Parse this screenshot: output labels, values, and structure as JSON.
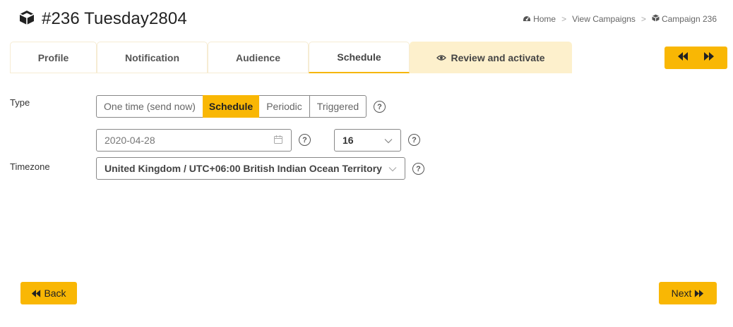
{
  "header": {
    "title": "#236 Tuesday2804",
    "title_icon": "cube-icon"
  },
  "breadcrumb": {
    "items": [
      {
        "label": "Home",
        "icon": "dashboard-icon"
      },
      {
        "label": "View Campaigns"
      },
      {
        "label": "Campaign 236",
        "icon": "cube-icon"
      }
    ],
    "separator": ">"
  },
  "tabs": [
    {
      "label": "Profile"
    },
    {
      "label": "Notification"
    },
    {
      "label": "Audience"
    },
    {
      "label": "Schedule",
      "active": true
    },
    {
      "label": "Review and activate",
      "icon": "eye-icon"
    }
  ],
  "form": {
    "type_label": "Type",
    "type_options": [
      "One time (send now)",
      "Schedule",
      "Periodic",
      "Triggered"
    ],
    "type_selected": "Schedule",
    "date_value": "2020-04-28",
    "hour_value": "16",
    "timezone_label": "Timezone",
    "timezone_value": "United Kingdom / UTC+06:00 British Indian Ocean Territory",
    "help_glyph": "?"
  },
  "footer": {
    "back_label": "Back",
    "next_label": "Next"
  },
  "colors": {
    "accent": "#f9b704",
    "review_tab_bg": "#fdf0cc"
  }
}
